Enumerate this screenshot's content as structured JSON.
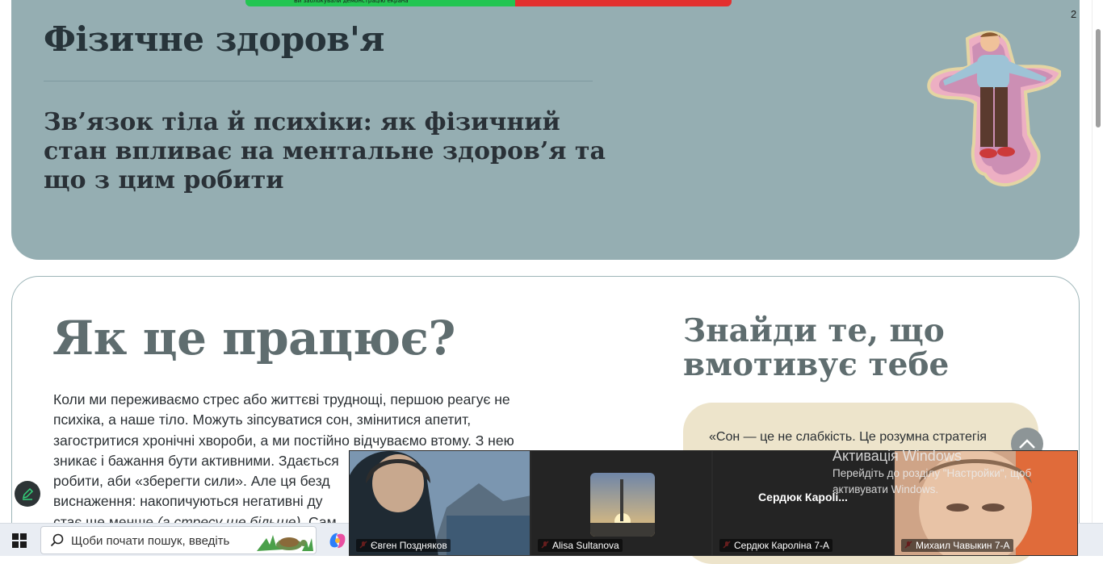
{
  "share_bar": {
    "text": "Ви заблокували демонстрацію екрана"
  },
  "hero": {
    "title": "Фізичне здоров'я",
    "subtitle": "Зв’язок тіла й психіки: як фізичний стан впливає на ментальне здоров’я та що з цим робити"
  },
  "main": {
    "how_title": "Як це працює?",
    "body_lines": [
      "Коли ми переживаємо стрес або життєві труднощі, першою реагує не",
      "психіка, а наше тіло. Можуть зіпсуватися сон, змінитися апетит,",
      "загостритися хронічні хвороби, а ми постійно відчуваємо втому. З нею",
      "зникає і бажання бути активними. Здається",
      "робити, аби «зберегти сили». Але ця безд",
      "виснаження: накопичуються негативні ду",
      "стає ще менше ",
      "(а стресу ще більше)",
      ". Сам"
    ],
    "find_title": "Знайди те, що вмотивує тебе",
    "quote": "«Сон — це не слабкість. Це розумна стратегія"
  },
  "watermark": {
    "title": "Активація Windows",
    "line1": "Перейдіть до розділу \"Настройки\", щоб",
    "line2": "активувати Windows."
  },
  "video": {
    "tiles": [
      {
        "name": "Євген Поздняков"
      },
      {
        "name": "Alisa Sultanova"
      },
      {
        "name": "Сердюк Кароліна 7-А",
        "center_label": "Сердюк  Кароlі..."
      },
      {
        "name": "Михаил Чавыкин 7-А"
      }
    ]
  },
  "taskbar": {
    "search_placeholder": "Щоби почати пошук, введіть",
    "tray_badge": "2"
  },
  "colors": {
    "hero_bg": "#95aeb2",
    "quote_bg": "#ede4cb",
    "heading_gray": "#5f6d6f"
  }
}
